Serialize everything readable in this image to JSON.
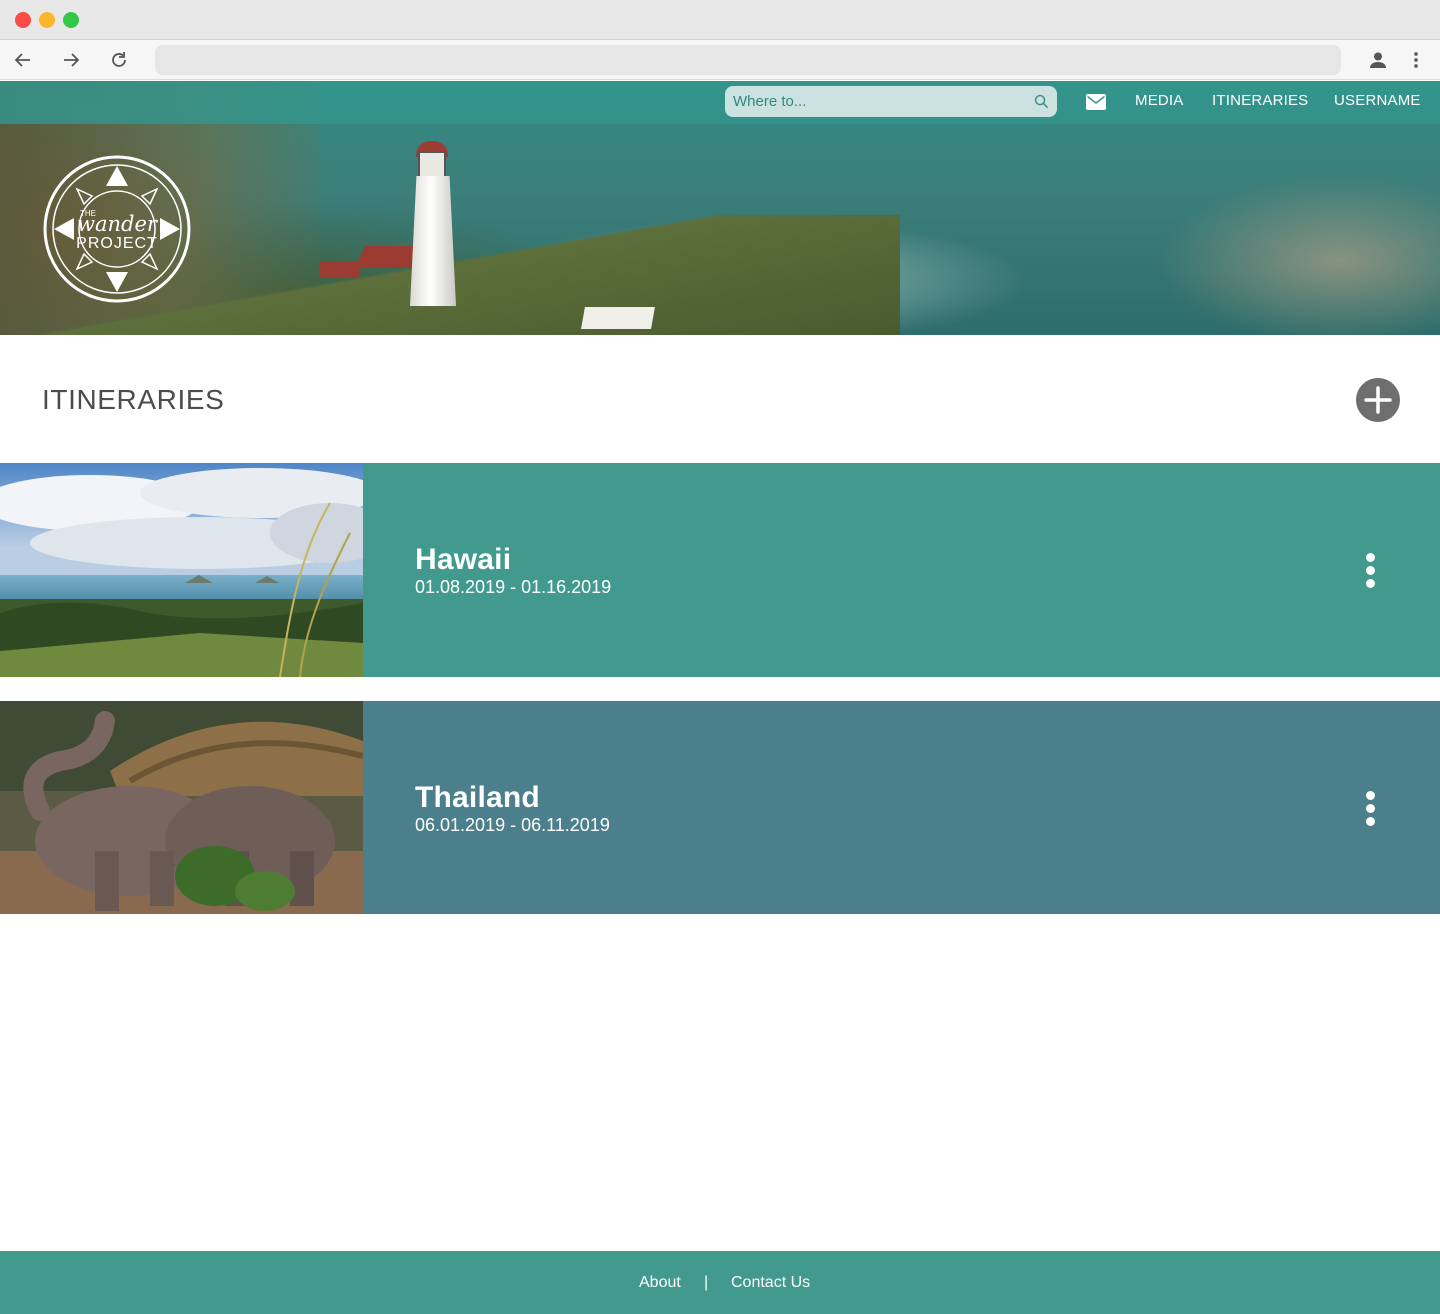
{
  "browser": {
    "address": "",
    "icons": [
      "back-arrow-icon",
      "forward-arrow-icon",
      "reload-icon",
      "profile-icon",
      "kebab-menu-icon"
    ]
  },
  "nav": {
    "search_placeholder": "Where to...",
    "links": [
      "MEDIA",
      "ITINERARIES",
      "USERNAME"
    ]
  },
  "logo": {
    "line1": "THE",
    "line2": "wander",
    "line3": "PROJECT"
  },
  "main": {
    "title": "ITINERARIES",
    "itineraries": [
      {
        "name": "Hawaii",
        "dates": "01.08.2019 - 01.16.2019",
        "color": "#419a8d"
      },
      {
        "name": "Thailand",
        "dates": "06.01.2019 - 06.11.2019",
        "color": "#4c7f8c"
      }
    ]
  },
  "footer": {
    "about": "About",
    "separator": "|",
    "contact": "Contact Us",
    "color": "#419a8d"
  }
}
